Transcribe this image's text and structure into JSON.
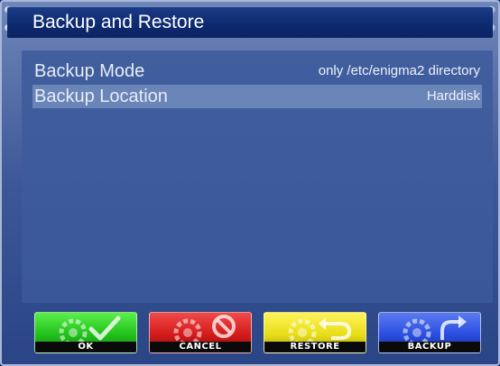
{
  "window": {
    "title": "Backup and Restore"
  },
  "settings": [
    {
      "label": "Backup Mode",
      "value": "only /etc/enigma2 directory",
      "selected": false
    },
    {
      "label": "Backup Location",
      "value": "Harddisk",
      "selected": true
    }
  ],
  "buttons": [
    {
      "label": "OK",
      "color": "#22c01c",
      "icon": "checkmark-icon"
    },
    {
      "label": "CANCEL",
      "color": "#d41a1a",
      "icon": "cancel-icon"
    },
    {
      "label": "RESTORE",
      "color": "#e8de18",
      "icon": "undo-arrow-icon"
    },
    {
      "label": "BACKUP",
      "color": "#2a4ee0",
      "icon": "redo-arrow-icon"
    }
  ]
}
